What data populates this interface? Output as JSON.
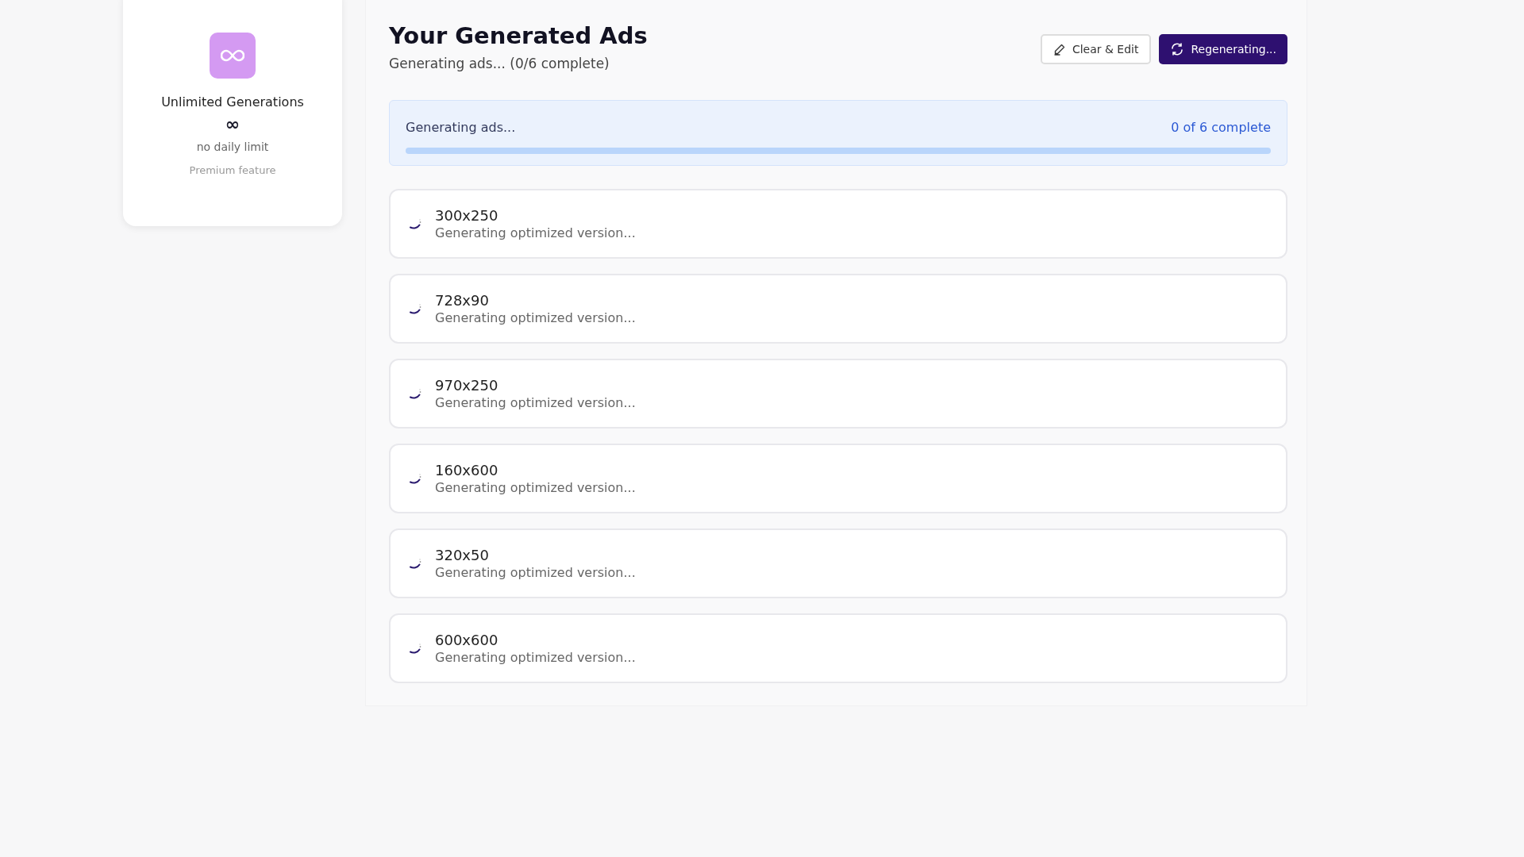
{
  "plan_card": {
    "title": "Unlimited Generations",
    "symbol": "∞",
    "limit": "no daily limit",
    "note": "Premium feature"
  },
  "header": {
    "title": "Your Generated Ads",
    "subtitle": "Generating ads... (0/6 complete)"
  },
  "buttons": [
    {
      "kind": "outline",
      "label": "Clear & Edit"
    },
    {
      "kind": "primary",
      "label": "Regenerating..."
    }
  ],
  "progress": {
    "label": "Generating ads...",
    "count": "0 of 6 complete",
    "level": 0
  },
  "ads": [
    {
      "size": "300x250",
      "status": "Generating optimized version..."
    },
    {
      "size": "728x90",
      "status": "Generating optimized version..."
    },
    {
      "size": "970x250",
      "status": "Generating optimized version..."
    },
    {
      "size": "160x600",
      "status": "Generating optimized version..."
    },
    {
      "size": "320x50",
      "status": "Generating optimized version..."
    },
    {
      "size": "600x600",
      "status": "Generating optimized version..."
    }
  ]
}
